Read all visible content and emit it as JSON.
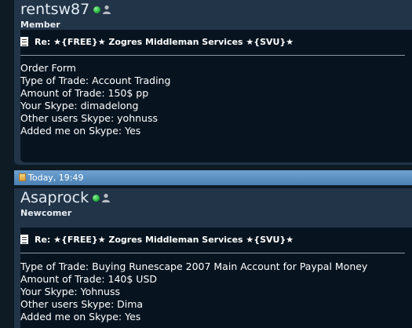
{
  "posts": [
    {
      "username": "rentsw87",
      "user_title": "Member",
      "online_status_icon": "green-dot-online-icon",
      "profile_icon": "user-silhouette-icon",
      "title": "Re: ★{FREE}★ Zogres Middleman Services ★{SVU}★",
      "lines": [
        "Order Form",
        "Type of Trade: Account Trading",
        "Amount of Trade: 150$ pp",
        "Your Skype: dimadelong",
        "Other users Skype: yohnuss",
        "Added me on Skype: Yes"
      ]
    },
    {
      "date": "Today, 19:49",
      "username": "Asaprock",
      "user_title": "Newcomer",
      "online_status_icon": "green-dot-online-icon",
      "profile_icon": "user-silhouette-icon",
      "title": "Re: ★{FREE}★ Zogres Middleman Services ★{SVU}★",
      "lines": [
        "Type of Trade: Buying Runescape 2007 Main Account for Paypal Money",
        "Amount of Trade: 140$ USD",
        "Your Skype: Yohnuss",
        "Other users Skype: Dima",
        "Added me on Skype: Yes"
      ]
    }
  ],
  "colors": {
    "page_bg": "#0e1a24",
    "post_bg": "#223447",
    "message_bg": "#071420",
    "date_bar": "#5a8fc2",
    "online": "#23b23a"
  }
}
